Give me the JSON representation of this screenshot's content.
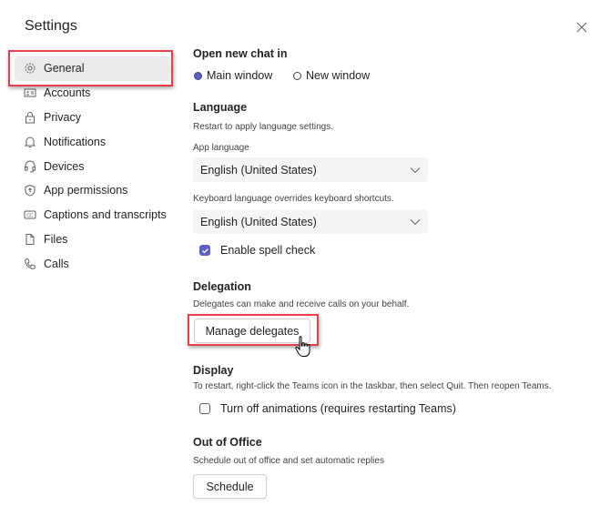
{
  "window": {
    "title": "Settings",
    "close_icon": "close-icon"
  },
  "sidebar": {
    "items": [
      {
        "label": "General",
        "icon": "gear-icon",
        "active": true
      },
      {
        "label": "Accounts",
        "icon": "account-card-icon"
      },
      {
        "label": "Privacy",
        "icon": "lock-icon"
      },
      {
        "label": "Notifications",
        "icon": "bell-icon"
      },
      {
        "label": "Devices",
        "icon": "headset-icon"
      },
      {
        "label": "App permissions",
        "icon": "shield-icon"
      },
      {
        "label": "Captions and transcripts",
        "icon": "cc-icon"
      },
      {
        "label": "Files",
        "icon": "file-icon"
      },
      {
        "label": "Calls",
        "icon": "phone-icon"
      }
    ]
  },
  "main": {
    "open_new_chat": {
      "heading": "Open new chat in",
      "options": [
        {
          "label": "Main window",
          "selected": true
        },
        {
          "label": "New window",
          "selected": false
        }
      ]
    },
    "language": {
      "heading": "Language",
      "description": "Restart to apply language settings.",
      "app_language_label": "App language",
      "app_language_value": "English (United States)",
      "keyboard_label": "Keyboard language overrides keyboard shortcuts.",
      "keyboard_value": "English (United States)",
      "spell_check_label": "Enable spell check",
      "spell_check_checked": true
    },
    "delegation": {
      "heading": "Delegation",
      "description": "Delegates can make and receive calls on your behalf.",
      "button_label": "Manage delegates"
    },
    "display": {
      "heading": "Display",
      "description": "To restart, right-click the Teams icon in the taskbar, then select Quit. Then reopen Teams.",
      "animations_label": "Turn off animations (requires restarting Teams)",
      "animations_checked": false
    },
    "out_of_office": {
      "heading": "Out of Office",
      "description": "Schedule out of office and set automatic replies",
      "button_label": "Schedule"
    }
  },
  "colors": {
    "accent": "#5b5fc7",
    "highlight": "#e8414b"
  }
}
